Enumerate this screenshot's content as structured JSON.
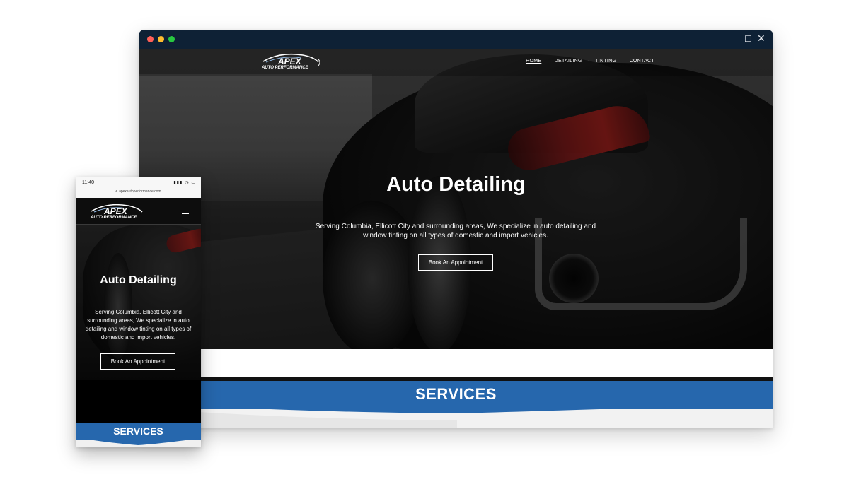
{
  "desktop": {
    "window_controls": {
      "minimize": "—",
      "maximize": "☐",
      "close": "✕"
    },
    "logo": {
      "main": "APEX",
      "sub": "AUTO PERFORMANCE"
    },
    "nav": [
      {
        "label": "HOME",
        "active": true
      },
      {
        "label": "DETAILING",
        "active": false
      },
      {
        "label": "TINTING",
        "active": false
      },
      {
        "label": "CONTACT",
        "active": false
      }
    ],
    "hero": {
      "title": "Auto Detailing",
      "text": "Serving Columbia, Ellicott City and surrounding areas, We specialize in auto detailing and window tinting on all types of domestic and import vehicles.",
      "button": "Book An Appointment"
    },
    "services_title": "SERVICES"
  },
  "mobile": {
    "status": {
      "time": "11:40",
      "icons": "▮▮▮ ◔ ▭"
    },
    "url": "apexautoperformance.com",
    "logo": {
      "main": "APEX",
      "sub": "AUTO PERFORMANCE"
    },
    "hero": {
      "title": "Auto Detailing",
      "text": "Serving Columbia, Ellicott City and surrounding areas, We specialize in auto detailing and window tinting on all types of domestic and import vehicles.",
      "button": "Book An Appointment"
    },
    "services_title": "SERVICES"
  },
  "colors": {
    "window_bar": "#0e2135",
    "accent_blue": "#2667ad",
    "dark": "#0d0d0d"
  },
  "icons": [
    "close-icon",
    "minimize-icon",
    "maximize-icon",
    "hamburger-menu-icon",
    "lock-icon",
    "logo-car-icon"
  ]
}
